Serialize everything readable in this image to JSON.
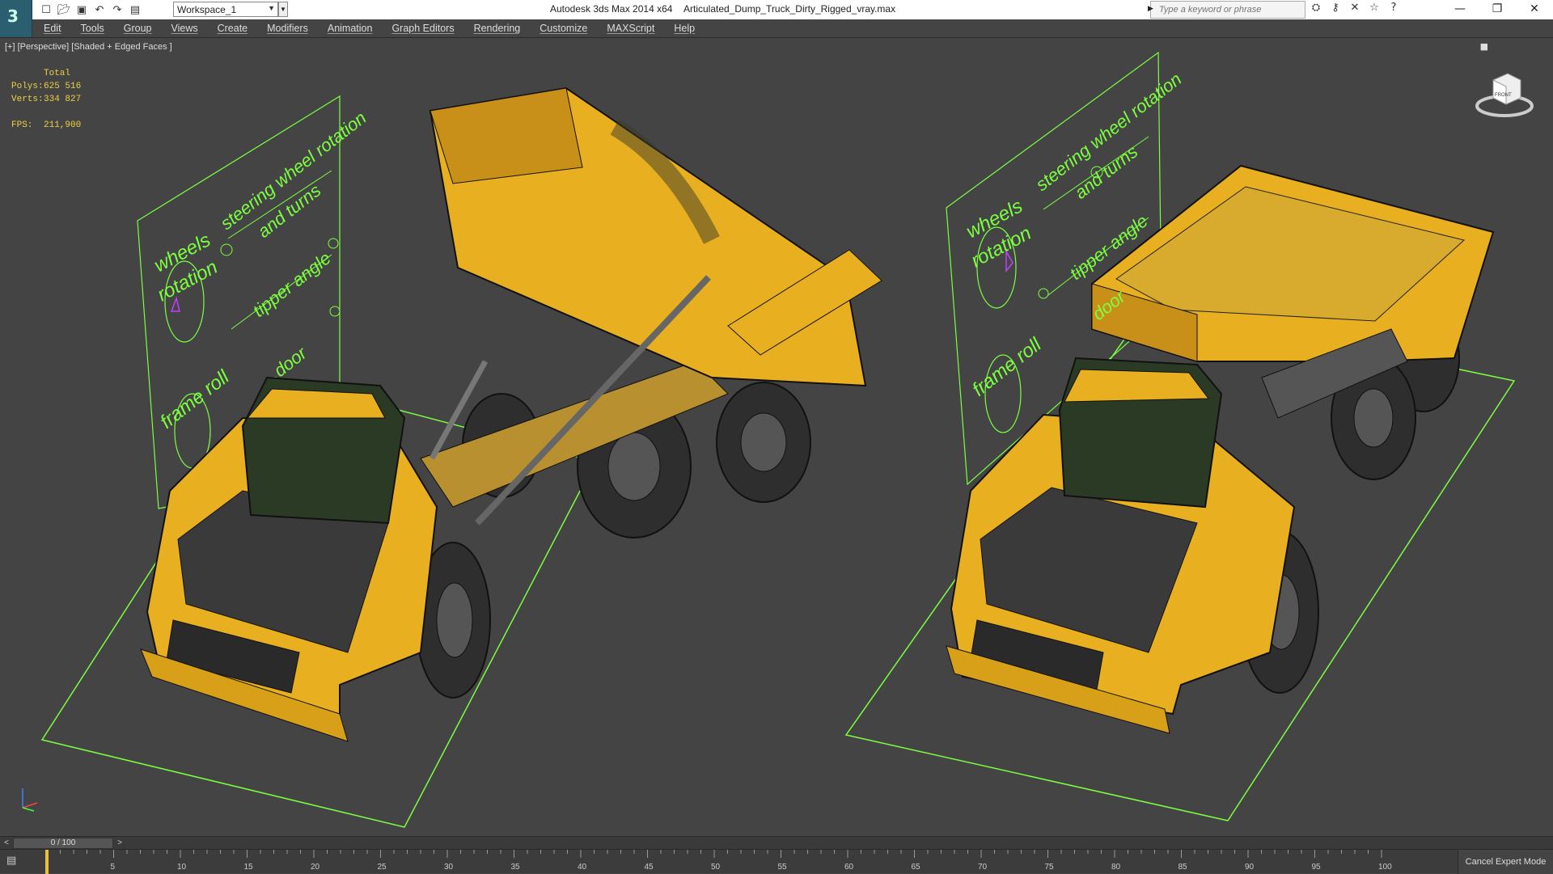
{
  "titlebar": {
    "app_title": "Autodesk 3ds Max  2014 x64",
    "file_name": "Articulated_Dump_Truck_Dirty_Rigged_vray.max",
    "workspace": "Workspace_1",
    "search_placeholder": "Type a keyword or phrase"
  },
  "menu": [
    "Edit",
    "Tools",
    "Group",
    "Views",
    "Create",
    "Modifiers",
    "Animation",
    "Graph Editors",
    "Rendering",
    "Customize",
    "MAXScript",
    "Help"
  ],
  "viewport": {
    "label": "[+] [Perspective] [Shaded + Edged Faces ]",
    "stats": {
      "total_label": "Total",
      "polys_label": "Polys:",
      "polys": "625 516",
      "verts_label": "Verts:",
      "verts": "334 827",
      "fps_label": "FPS:",
      "fps": "211,900"
    },
    "viewcube_label": "FRONT",
    "rig_labels_left": [
      "wheels",
      "rotation",
      "steering wheel rotation",
      "and turns",
      "tipper angle",
      "frame roll",
      "door"
    ],
    "rig_labels_right": [
      "wheels",
      "rotation",
      "steering wheel rotation",
      "and turns",
      "tipper angle",
      "frame roll",
      "door"
    ]
  },
  "timeline": {
    "frame_display": "0 / 100",
    "ticks": [
      "0",
      "5",
      "10",
      "15",
      "20",
      "25",
      "30",
      "35",
      "40",
      "45",
      "50",
      "55",
      "60",
      "65",
      "70",
      "75",
      "80",
      "85",
      "90",
      "95",
      "100"
    ]
  },
  "status": {
    "expert_mode": "Cancel Expert Mode"
  },
  "colors": {
    "viewport_bg": "#444444",
    "truck_yellow": "#e8b020",
    "rig_green": "#7cff40",
    "stats_yellow": "#f0d040"
  }
}
